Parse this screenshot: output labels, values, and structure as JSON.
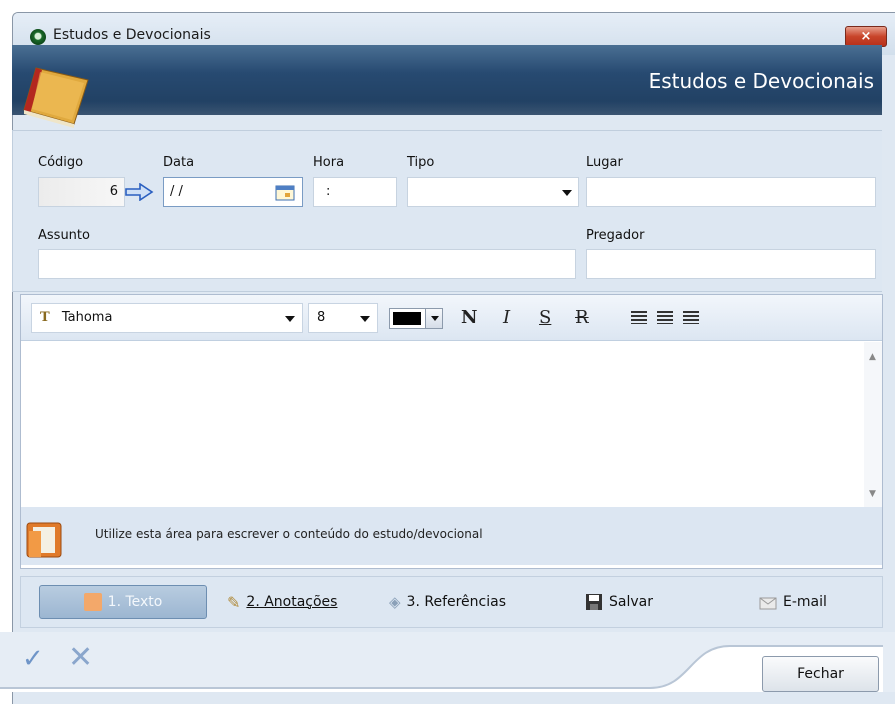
{
  "window": {
    "title": "Estudos e Devocionais",
    "close_label": "×"
  },
  "banner": {
    "title": "Estudos e Devocionais"
  },
  "form": {
    "codigo": {
      "label": "Código",
      "value": "6"
    },
    "data": {
      "label": "Data",
      "value": " / /"
    },
    "hora": {
      "label": "Hora",
      "value": ":"
    },
    "tipo": {
      "label": "Tipo",
      "value": ""
    },
    "lugar": {
      "label": "Lugar",
      "value": ""
    },
    "assunto": {
      "label": "Assunto",
      "value": ""
    },
    "pregador": {
      "label": "Pregador",
      "value": ""
    }
  },
  "editor": {
    "font_name": "Tahoma",
    "font_size": "8",
    "bold_label": "N",
    "italic_label": "I",
    "underline_label": "S",
    "strike_label": "R",
    "hint": "Utilize esta área para escrever o conteúdo do estudo/devocional"
  },
  "tabs": [
    {
      "label": "1. Texto"
    },
    {
      "label": "2. Anotações"
    },
    {
      "label": "3. Referências"
    },
    {
      "label": "Salvar"
    },
    {
      "label": "E-mail"
    }
  ],
  "footer": {
    "close_button": "Fechar"
  }
}
